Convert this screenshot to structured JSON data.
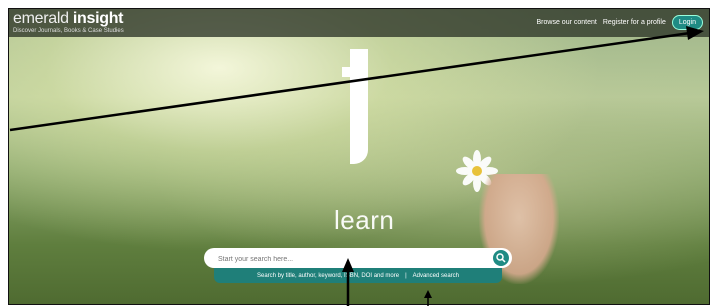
{
  "brand": {
    "name_light": "emerald",
    "name_bold": "insight",
    "tagline": "Discover Journals, Books & Case Studies"
  },
  "nav": {
    "browse": "Browse our content",
    "register": "Register for a profile",
    "login": "Login"
  },
  "hero": {
    "word": "learn"
  },
  "search": {
    "placeholder": "Start your search here...",
    "hint": "Search by title, author, keyword, ISBN, DOI and more",
    "separator": "|",
    "advanced": "Advanced search"
  },
  "colors": {
    "accent": "#1f8b84",
    "header_bg": "#2d3428"
  }
}
